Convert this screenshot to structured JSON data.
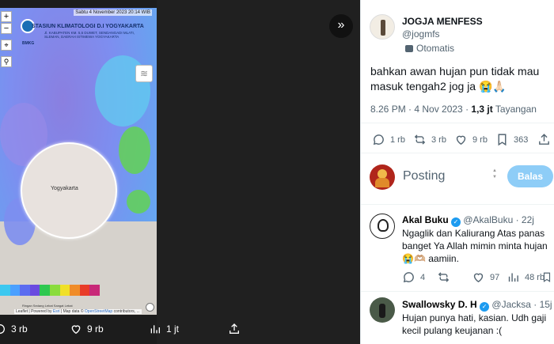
{
  "map": {
    "date": "Sabtu 4 November 2023 20:14 WIB",
    "title": "STASIUN KLIMATOLOGI D.I YOGYAKARTA",
    "address": "Jl. KABUPATEN KM. 5,5 DUWET, SENDANGADI MLATI, SLEMAN, DAERAH ISTIMEWA YOGYAKARTA",
    "logo_label": "BMKG",
    "city": "Yogyakarta",
    "attribution_prefix": "Leaflet | Powered by",
    "attribution_link1": "Esri",
    "attribution_mid": "| Map data ©",
    "attribution_link2": "OpenStreetMap",
    "attribution_suffix": "contributors, ...",
    "legend_caption": "Ringan  Sedang  Lebat  Sangat Lebat",
    "legend_colors": [
      "#3cc8f0",
      "#4aa0ff",
      "#5b6cf0",
      "#6a4ae0",
      "#2ec850",
      "#8adc3c",
      "#f0e028",
      "#f08c28",
      "#e83c28",
      "#c82878"
    ]
  },
  "media_actions": {
    "replies": "3 rb",
    "likes": "9 rb",
    "views": "1 jt"
  },
  "tweet": {
    "author_name": "JOGJA MENFESS",
    "author_handle": "@jogmfs",
    "automated_label": "Otomatis",
    "text": "bahkan awan hujan pun tidak mau masuk tengah2 jog ja 😭🙏🏻",
    "time": "8.26 PM · 4 Nov 2023 ·",
    "views_count": "1,3 jt",
    "views_label": "Tayangan",
    "stats": {
      "replies": "1 rb",
      "retweets": "3 rb",
      "likes": "9 rb",
      "bookmarks": "363"
    }
  },
  "compose": {
    "placeholder": "Posting",
    "reply_button": "Balas"
  },
  "replies": [
    {
      "name": "Akal Buku",
      "handle": "@AkalBuku · 22j",
      "text": "Ngaglik dan Kaliurang Atas panas banget Ya Allah mimin minta hujan 😭🫶🏼 aamiin.",
      "stats": {
        "replies": "4",
        "retweets": "",
        "likes": "97",
        "views": "48 rb"
      }
    },
    {
      "name": "Swallowsky D. H",
      "handle": "@Jacksa · 15j",
      "text": "Hujan punya hati, kasian. Udh gaji kecil pulang keujanan :("
    }
  ],
  "colors": {
    "accent": "#1d9bf0",
    "reply_button": "#8ecdf7",
    "muted": "#536471"
  }
}
